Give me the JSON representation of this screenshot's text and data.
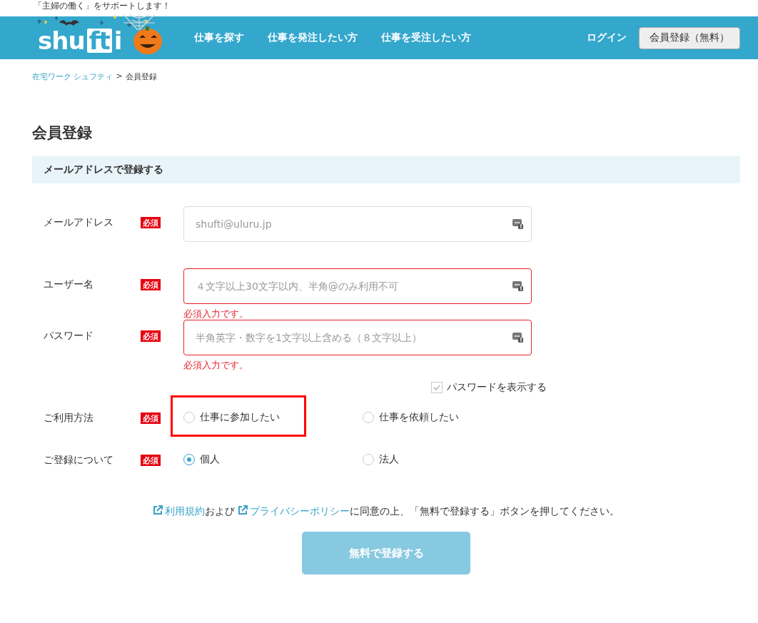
{
  "tagline": "「主婦の働く」をサポートします！",
  "header": {
    "logo": [
      "shu",
      "ft",
      "i"
    ],
    "nav": [
      "仕事を探す",
      "仕事を発注したい方",
      "仕事を受注したい方"
    ],
    "login": "ログイン",
    "signup_button": "会員登録（無料）"
  },
  "breadcrumb": [
    {
      "label": "在宅ワーク シュフティ",
      "link": true
    },
    {
      "label": ">",
      "link": false
    },
    {
      "label": "会員登録",
      "link": false
    }
  ],
  "page_title": "会員登録",
  "section_title": "メールアドレスで登録する",
  "fields": [
    {
      "label": "メールアドレス",
      "badge": "必須",
      "placeholder": "shufti@uluru.jp",
      "invalid": false
    },
    {
      "label": "ユーザー名",
      "badge": "必須",
      "placeholder": "４文字以上30文字以内、半角@のみ利用不可",
      "invalid": true,
      "error": "必須入力です。"
    },
    {
      "label": "パスワード",
      "badge": "必須",
      "placeholder": "半角英字・数字を1文字以上含める（８文字以上）",
      "invalid": true,
      "error": "必須入力です。"
    }
  ],
  "show_password": {
    "label": "パスワードを表示する",
    "checked": true
  },
  "radio_groups": [
    {
      "label": "ご利用方法",
      "badge": "必須",
      "options": [
        {
          "label": "仕事に参加したい",
          "selected": false,
          "highlighted": true
        },
        {
          "label": "仕事を依頼したい",
          "selected": false,
          "highlighted": false
        }
      ]
    },
    {
      "label": "ご登録について",
      "badge": "必須",
      "options": [
        {
          "label": "個人",
          "selected": true,
          "highlighted": false
        },
        {
          "label": "法人",
          "selected": false,
          "highlighted": false
        }
      ]
    }
  ],
  "consent": {
    "terms_link": "利用規約",
    "and": "および",
    "privacy_link": "プライバシーポリシー",
    "rest": "に同意の上、「無料で登録する」ボタンを押してください。"
  },
  "submit_button": {
    "label": "無料で登録する",
    "disabled": true
  }
}
